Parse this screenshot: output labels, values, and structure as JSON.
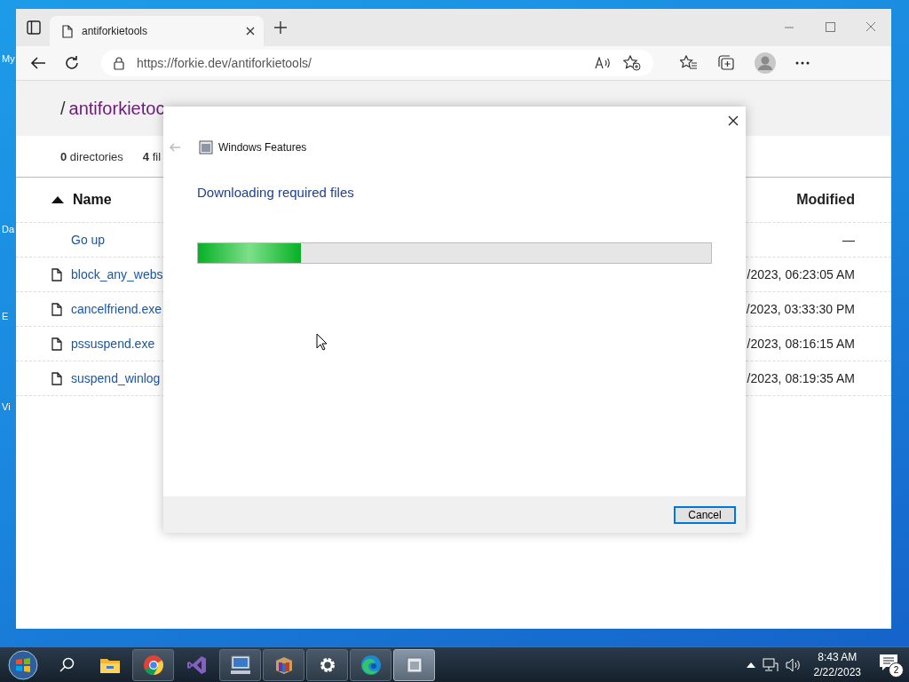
{
  "desktop_icons": [
    {
      "label": "My"
    },
    {
      "label": "Da"
    },
    {
      "label": "E"
    },
    {
      "label": "Vi"
    }
  ],
  "browser": {
    "tabs": [
      {
        "title": "antiforkietools",
        "selected": true
      }
    ],
    "url": "https://forkie.dev/antiforkietools/"
  },
  "page": {
    "separator": "/",
    "folder": "antiforkietoc",
    "stats": [
      "**0** directories",
      "**4** fil"
    ],
    "columns": [
      {
        "label": "Name",
        "sorted": true
      },
      {
        "label": "Modified",
        "sorted": false
      }
    ],
    "rows": [
      {
        "kind": "parent",
        "name": "Go up",
        "modified": "—"
      },
      {
        "kind": "file",
        "name": "block_any_webs",
        "modified": "/2023, 06:23:05 AM"
      },
      {
        "kind": "file",
        "name": "cancelfriend.exe",
        "modified": "/2023, 03:33:30 PM"
      },
      {
        "kind": "file",
        "name": "pssuspend.exe",
        "modified": "/2023, 08:16:15 AM"
      },
      {
        "kind": "file",
        "name": "suspend_winlog",
        "modified": "/2023, 08:19:35 AM"
      }
    ]
  },
  "dialog": {
    "title": "Windows Features",
    "heading": "Downloading required files",
    "progress": {
      "level": 0.2
    },
    "buttons": [
      {
        "label": "Cancel",
        "focused": true
      }
    ]
  },
  "taskbar": {
    "apps": [
      {
        "kind": "explorer",
        "running": false,
        "active": false
      },
      {
        "kind": "chrome",
        "running": true,
        "active": false
      },
      {
        "kind": "studio",
        "running": false,
        "active": false
      },
      {
        "kind": "remote",
        "running": true,
        "active": false
      },
      {
        "kind": "package",
        "running": true,
        "active": false
      },
      {
        "kind": "settings",
        "running": true,
        "active": false
      },
      {
        "kind": "edge",
        "running": true,
        "active": false
      },
      {
        "kind": "features",
        "running": true,
        "active": true
      }
    ],
    "time": "8:43 AM",
    "date": "2/22/2023",
    "notifications": "2"
  }
}
